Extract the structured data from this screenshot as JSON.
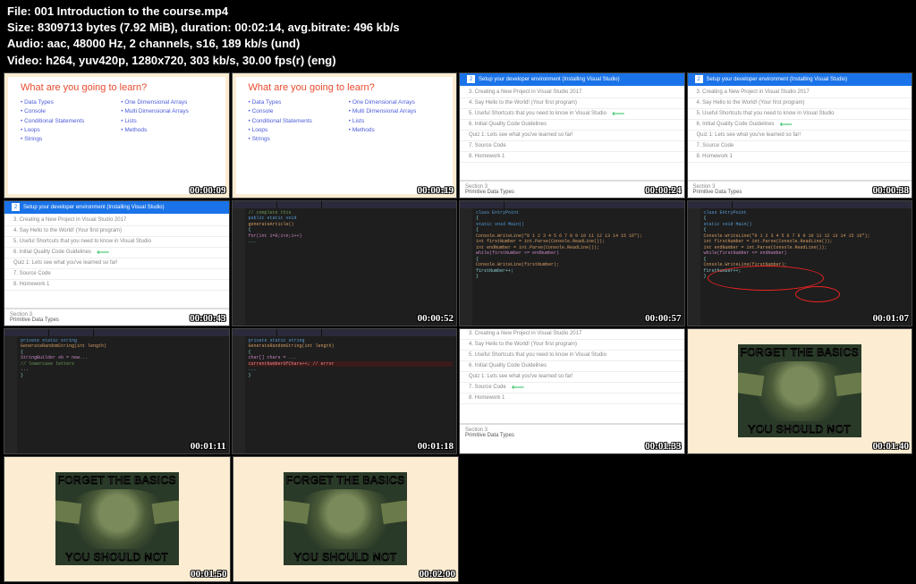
{
  "header": {
    "file_label": "File:",
    "file_value": "001 Introduction to the course.mp4",
    "size_label": "Size:",
    "size_value": "8309713 bytes (7.92 MiB),",
    "duration_label": "duration:",
    "duration_value": "00:02:14,",
    "bitrate_label": "avg.bitrate:",
    "bitrate_value": "496 kb/s",
    "audio_label": "Audio:",
    "audio_value": "aac, 48000 Hz, 2 channels, s16, 189 kb/s (und)",
    "video_label": "Video:",
    "video_value": "h264, yuv420p, 1280x720, 303 kb/s, 30.00 fps(r) (eng)"
  },
  "learn_slide": {
    "title": "What are you going to learn?",
    "col1": [
      "• Data Types",
      "• Console",
      "• Conditional Statements",
      "• Loops",
      "• Strings"
    ],
    "col2": [
      "• One Dimensional Arrays",
      "• Multi Dimensional Arrays",
      "• Lists",
      "• Methods"
    ]
  },
  "course_list": {
    "header_num": "2",
    "header_text": "Setup your developer environment (Installing Visual Studio)",
    "items": [
      "3. Creating a New Project in Visual Studio 2017",
      "4. Say Hello to the World! (Your first program)",
      "5. Useful Shortcuts that you need to know in Visual Studio",
      "6. Initial Quality Code Guidelines",
      "Quiz 1: Lets see what you've learned so far!",
      "7. Source Code",
      "8. Homework 1"
    ],
    "footer_section": "Section 3",
    "footer_title": "Primitive Data Types"
  },
  "code_snippet": {
    "l1": "class EntryPoint",
    "l2": "{",
    "l3": "  static void Main()",
    "l4": "  {",
    "l5": "    Console.WriteLine(\"0 1 2 3 4 5 6 7 8 9 10 11 12 13 14 15 16\");",
    "l6": "    int firstNumber = int.Parse(Console.ReadLine());",
    "l7": "    int endNumber = int.Parse(Console.ReadLine());",
    "l8": "    while(firstNumber <= endNumber)",
    "l9": "    {",
    "l10": "      Console.WriteLine(firstNumber);",
    "l11": "      firstNumber++;",
    "l12": "    }"
  },
  "meme": {
    "top": "FORGET THE BASICS",
    "bottom": "YOU SHOULD NOT"
  },
  "timestamps": {
    "t1": "00:00:09",
    "t2": "00:00:19",
    "t3": "00:00:24",
    "t4": "00:00:38",
    "t5": "00:00:43",
    "t6": "00:00:52",
    "t7": "00:00:57",
    "t8": "00:01:07",
    "t9": "00:01:11",
    "t10": "00:01:18",
    "t11": "00:01:33",
    "t12": "00:01:40",
    "t13": "00:01:50",
    "t14": "00:02:00"
  }
}
